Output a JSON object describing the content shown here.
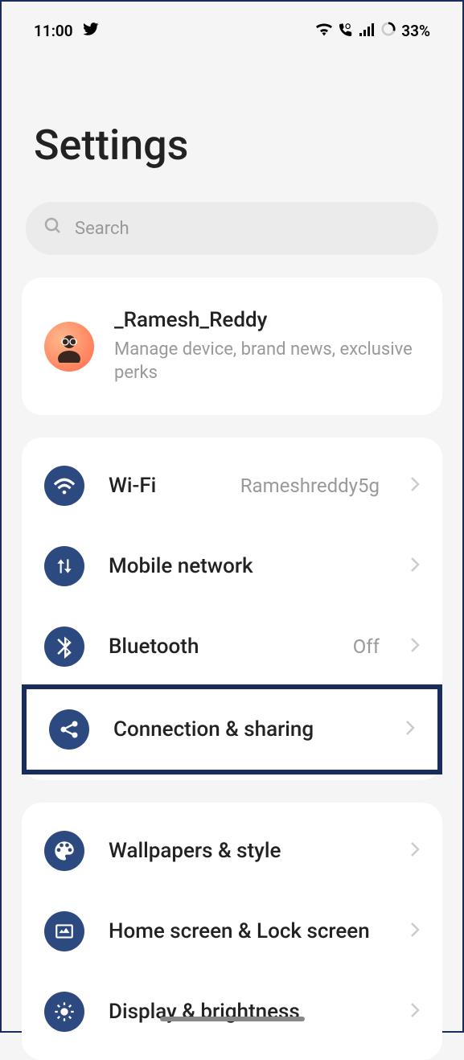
{
  "status": {
    "time": "11:00",
    "battery": "33%"
  },
  "page": {
    "title": "Settings"
  },
  "search": {
    "placeholder": "Search"
  },
  "account": {
    "name": "_Ramesh_Reddy",
    "subtitle": "Manage device, brand news, exclusive perks"
  },
  "group1": {
    "wifi": {
      "label": "Wi-Fi",
      "value": "Rameshreddy5g"
    },
    "mobile": {
      "label": "Mobile network"
    },
    "bluetooth": {
      "label": "Bluetooth",
      "value": "Off"
    },
    "connection": {
      "label": "Connection & sharing"
    }
  },
  "group2": {
    "wallpapers": {
      "label": "Wallpapers & style"
    },
    "homescreen": {
      "label": "Home screen & Lock screen"
    },
    "display": {
      "label": "Display & brightness"
    }
  }
}
